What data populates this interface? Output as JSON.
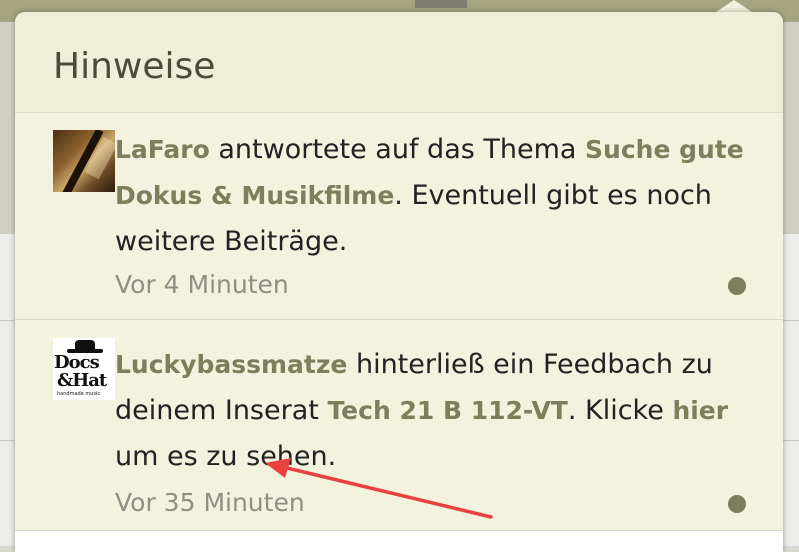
{
  "popover": {
    "title": "Hinweise"
  },
  "notifications": [
    {
      "user": "LaFaro",
      "text_before": " antwortete auf das Thema ",
      "link": "Suche gute Dokus & Musikfilme",
      "text_after": ". Eventuell gibt es noch weitere Beiträge.",
      "time": "Vor 4 Minuten",
      "unread": true
    },
    {
      "user": "Luckybassmatze",
      "text_before": " hinterließ ein Feedbach zu deinem Inserat ",
      "link": "Tech 21 B 112-VT",
      "text_mid": ". Klicke ",
      "link2": "hier",
      "text_after": " um es zu sehen.",
      "time": "Vor 35 Minuten",
      "unread": true,
      "avatar_logo": {
        "line1": "Docs",
        "line2": "&Hat",
        "tagline": "handmade music"
      }
    }
  ],
  "colors": {
    "popover_bg": "#f2f2df",
    "link": "#7e7e5c",
    "unread_dot": "#7d7d5f",
    "annotation_arrow": "#e8413f"
  },
  "icons": {
    "unread": "unread-dot-icon",
    "annotation": "red-arrow-icon"
  }
}
